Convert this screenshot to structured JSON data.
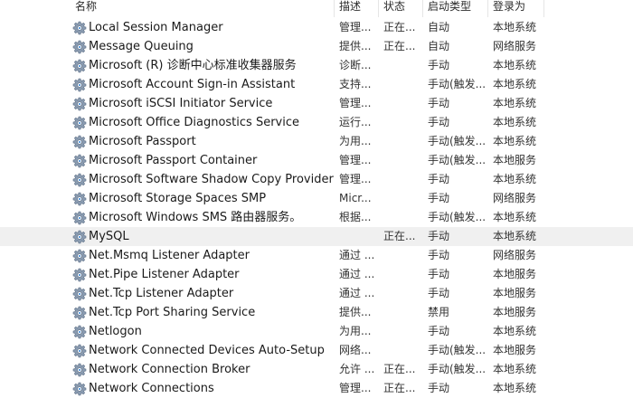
{
  "columns": {
    "name": "名称",
    "description": "描述",
    "status": "状态",
    "startup_type": "启动类型",
    "log_on_as": "登录为"
  },
  "row_icon": "gear-icon",
  "rows": [
    {
      "name": "Local Session Manager",
      "description": "管理...",
      "status": "正在...",
      "startup_type": "自动",
      "log_on_as": "本地系统"
    },
    {
      "name": "Message Queuing",
      "description": "提供...",
      "status": "正在...",
      "startup_type": "自动",
      "log_on_as": "网络服务"
    },
    {
      "name": "Microsoft (R) 诊断中心标准收集器服务",
      "description": "诊断...",
      "status": "",
      "startup_type": "手动",
      "log_on_as": "本地系统"
    },
    {
      "name": "Microsoft Account Sign-in Assistant",
      "description": "支持...",
      "status": "",
      "startup_type": "手动(触发...",
      "log_on_as": "本地系统"
    },
    {
      "name": "Microsoft iSCSI Initiator Service",
      "description": "管理...",
      "status": "",
      "startup_type": "手动",
      "log_on_as": "本地系统"
    },
    {
      "name": "Microsoft Office Diagnostics Service",
      "description": "运行...",
      "status": "",
      "startup_type": "手动",
      "log_on_as": "本地系统"
    },
    {
      "name": "Microsoft Passport",
      "description": "为用...",
      "status": "",
      "startup_type": "手动(触发...",
      "log_on_as": "本地系统"
    },
    {
      "name": "Microsoft Passport Container",
      "description": "管理...",
      "status": "",
      "startup_type": "手动(触发...",
      "log_on_as": "本地服务"
    },
    {
      "name": "Microsoft Software Shadow Copy Provider",
      "description": "管理...",
      "status": "",
      "startup_type": "手动",
      "log_on_as": "本地系统"
    },
    {
      "name": "Microsoft Storage Spaces SMP",
      "description": "Micr...",
      "status": "",
      "startup_type": "手动",
      "log_on_as": "网络服务"
    },
    {
      "name": "Microsoft Windows SMS 路由器服务。",
      "description": "根据...",
      "status": "",
      "startup_type": "手动(触发...",
      "log_on_as": "本地系统"
    },
    {
      "name": "MySQL",
      "description": "",
      "status": "正在...",
      "startup_type": "手动",
      "log_on_as": "本地系统",
      "selected": true
    },
    {
      "name": "Net.Msmq Listener Adapter",
      "description": "通过 ...",
      "status": "",
      "startup_type": "手动",
      "log_on_as": "网络服务"
    },
    {
      "name": "Net.Pipe Listener Adapter",
      "description": "通过 ...",
      "status": "",
      "startup_type": "手动",
      "log_on_as": "本地服务"
    },
    {
      "name": "Net.Tcp Listener Adapter",
      "description": "通过 ...",
      "status": "",
      "startup_type": "手动",
      "log_on_as": "本地服务"
    },
    {
      "name": "Net.Tcp Port Sharing Service",
      "description": "提供...",
      "status": "",
      "startup_type": "禁用",
      "log_on_as": "本地服务"
    },
    {
      "name": "Netlogon",
      "description": "为用...",
      "status": "",
      "startup_type": "手动",
      "log_on_as": "本地系统"
    },
    {
      "name": "Network Connected Devices Auto-Setup",
      "description": "网络...",
      "status": "",
      "startup_type": "手动(触发...",
      "log_on_as": "本地服务"
    },
    {
      "name": "Network Connection Broker",
      "description": "允许 ...",
      "status": "正在...",
      "startup_type": "手动(触发...",
      "log_on_as": "本地系统"
    },
    {
      "name": "Network Connections",
      "description": "管理...",
      "status": "正在...",
      "startup_type": "手动",
      "log_on_as": "本地系统"
    }
  ]
}
